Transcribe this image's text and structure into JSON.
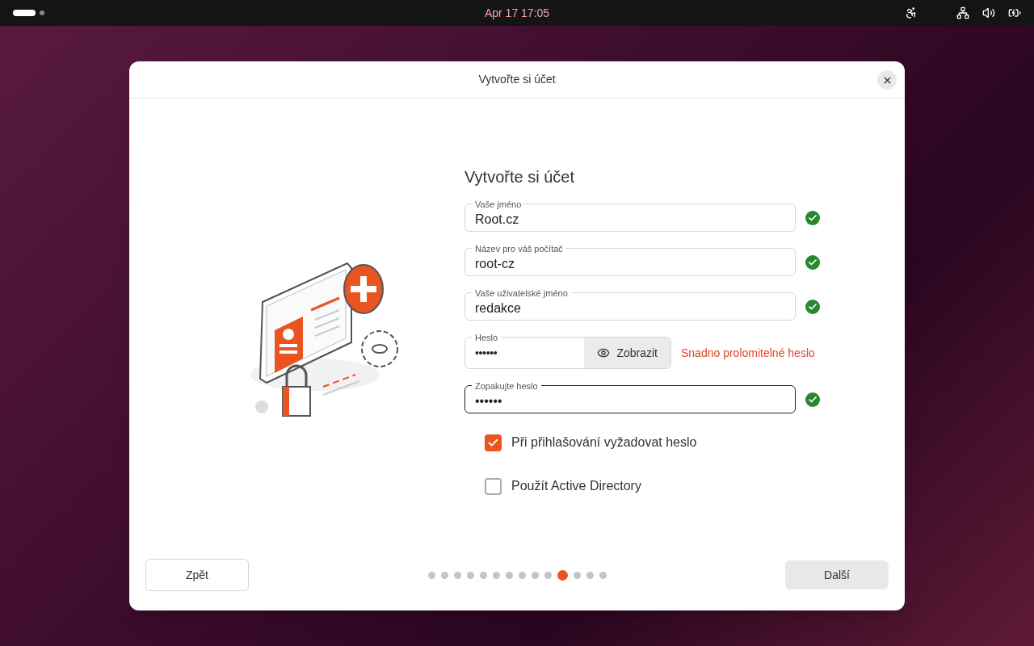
{
  "top_bar": {
    "clock": "Apr 17  17:05"
  },
  "window": {
    "title": "Vytvořte si účet"
  },
  "form": {
    "heading": "Vytvořte si účet",
    "fields": [
      {
        "kind": "text",
        "label": "Vaše jméno",
        "value": "Root.cz",
        "valid": true,
        "focused": false
      },
      {
        "kind": "text",
        "label": "Název pro váš počítač",
        "value": "root-cz",
        "valid": true,
        "focused": false
      },
      {
        "kind": "text",
        "label": "Vaše uživatelské jméno",
        "value": "redakce",
        "valid": true,
        "focused": false
      },
      {
        "kind": "password",
        "label": "Heslo",
        "value": "••••••",
        "reveal_button": "Zobrazit",
        "strength": "Snadno prolomitelné heslo",
        "focused": false
      },
      {
        "kind": "text",
        "label": "Zopakujte heslo",
        "value": "••••••",
        "valid": true,
        "focused": true
      }
    ],
    "options": [
      {
        "label": "Při přihlašování vyžadovat heslo",
        "checked": true
      },
      {
        "label": "Použít Active Directory",
        "checked": false
      }
    ]
  },
  "footer": {
    "back_button": "Zpět",
    "next_button": "Další",
    "steps": [
      {
        "selected": false
      },
      {
        "selected": false
      },
      {
        "selected": false
      },
      {
        "selected": false
      },
      {
        "selected": false
      },
      {
        "selected": false
      },
      {
        "selected": false
      },
      {
        "selected": false
      },
      {
        "selected": false
      },
      {
        "selected": false
      },
      {
        "selected": true
      },
      {
        "selected": false
      },
      {
        "selected": false
      },
      {
        "selected": false
      }
    ]
  }
}
